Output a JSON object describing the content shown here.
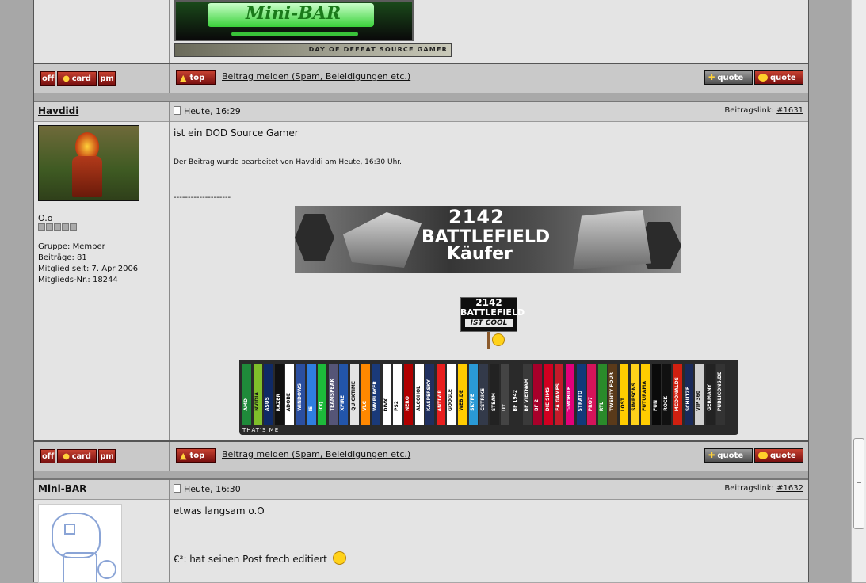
{
  "buttons": {
    "off": "off",
    "card": "card",
    "pm": "pm",
    "top": "top",
    "quote": "quote",
    "report": "Beitrag melden (Spam, Beleidigungen etc.)"
  },
  "prev_post": {
    "sig_banner_text": "Mini-BAR",
    "sig_strip_text": "DAY OF DEFEAT SOURCE GAMER"
  },
  "posts": [
    {
      "author": "Havdidi",
      "date": "Heute, 16:29",
      "link_label": "Beitragslink:",
      "link": "#1631",
      "rank": "O.o",
      "group": "Gruppe: Member",
      "posts": "Beiträge: 81",
      "member_since": "Mitglied seit: 7. Apr 2006",
      "member_no": "Mitglieds-Nr.: 18244",
      "body": "ist ein DOD Source Gamer",
      "edit_note": "Der Beitrag wurde bearbeitet von Havdidi am Heute, 16:30 Uhr.",
      "separator": "--------------------",
      "banner_number": "2142",
      "banner_line1": "BATTLEFIELD",
      "banner_line2": "Käufer",
      "sign_number": "2142",
      "sign_line1": "BATTLEFIELD",
      "sign_line2": "IST COOL",
      "badges_footer": "THAT'S ME!",
      "badges": [
        "AMD",
        "NVIDIA",
        "ASUS",
        "RAZER",
        "ADOBE",
        "WINDOWS",
        "IE",
        "ICQ",
        "TEAMSPEAK",
        "XFIRE",
        "QUICKTIME",
        "VLC",
        "WMPLAYER",
        "DIVX",
        "PS2",
        "NERO",
        "ALCOHOL",
        "KASPERSKY",
        "ANTIVIR",
        "GOOGLE",
        "WEB.DE",
        "SKYPE",
        "CSTRIKE",
        "STEAM",
        "UT",
        "BF 1942",
        "BF VIETNAM",
        "BF 2",
        "DIE SIMS",
        "EA GAMES",
        "T-MOBILE",
        "STRATO",
        "PRO7",
        "RTL",
        "TWENTY FOUR",
        "LOST",
        "SIMPSONS",
        "FUTURAMA",
        "FUN",
        "ROCK",
        "MCDONALDS",
        "SCHÜTZE",
        "VIP 360",
        "GERMANY",
        "PUBLICONS.DE"
      ]
    },
    {
      "author": "Mini-BAR",
      "date": "Heute, 16:30",
      "link_label": "Beitragslink:",
      "link": "#1632",
      "body": "etwas langsam o.O",
      "body2": "€²: hat seinen Post frech editiert"
    }
  ],
  "colors": {
    "page_bg": "#a7a7a7",
    "content_bg": "#e4e4e4",
    "button_red": "#a02a1c",
    "badge_colors": [
      "#1f8a3a",
      "#7fbf2a",
      "#0f2a66",
      "#111111",
      "#ffffff",
      "#2b4fa0",
      "#2f7ee0",
      "#1dba3a",
      "#555577",
      "#2255aa",
      "#e3e3e3",
      "#ff8800",
      "#1a3a7a",
      "#ffffff",
      "#ffffff",
      "#b00000",
      "#ffffff",
      "#1f2f5f",
      "#e81e1e",
      "#ffffff",
      "#ffcc00",
      "#2a9ad6",
      "#333a4a",
      "#222222",
      "#444444",
      "#2a2a2a",
      "#3a3a3a",
      "#a8002a",
      "#d00020",
      "#c51a2a",
      "#e2007a",
      "#123a7a",
      "#d4145a",
      "#2a8a2a",
      "#5a3a1a",
      "#ffcc00",
      "#ffd21a",
      "#ffcc00",
      "#0a0a0a",
      "#111111",
      "#d02010",
      "#1a2a5a",
      "#cfcfcf",
      "#222222",
      "#333333"
    ]
  }
}
